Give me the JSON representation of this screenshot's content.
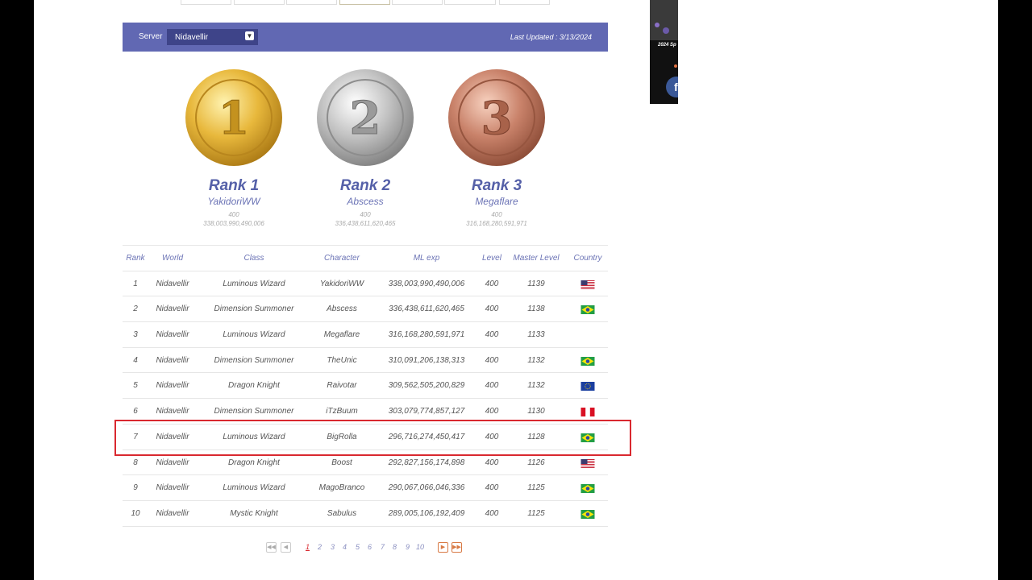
{
  "header": {
    "server_label": "Server",
    "server_value": "Nidavellir",
    "last_updated": "Last Updated : 3/13/2024"
  },
  "podium": [
    {
      "rank": "Rank 1",
      "name": "YakidoriWW",
      "level": "400",
      "exp": "338,003,990,490,006",
      "numeral": "1",
      "color": "#d9a632"
    },
    {
      "rank": "Rank 2",
      "name": "Abscess",
      "level": "400",
      "exp": "336,438,611,620,465",
      "numeral": "2",
      "color": "#a8a8a8"
    },
    {
      "rank": "Rank 3",
      "name": "Megaflare",
      "level": "400",
      "exp": "316,168,280,591,971",
      "numeral": "3",
      "color": "#c0775b"
    }
  ],
  "table": {
    "headers": {
      "rank": "Rank",
      "world": "World",
      "class": "Class",
      "character": "Character",
      "mlexp": "ML exp",
      "level": "Level",
      "master": "Master Level",
      "country": "Country"
    },
    "rows": [
      {
        "rank": "1",
        "world": "Nidavellir",
        "class": "Luminous Wizard",
        "character": "YakidoriWW",
        "mlexp": "338,003,990,490,006",
        "level": "400",
        "master": "1139",
        "flag": "us"
      },
      {
        "rank": "2",
        "world": "Nidavellir",
        "class": "Dimension Summoner",
        "character": "Abscess",
        "mlexp": "336,438,611,620,465",
        "level": "400",
        "master": "1138",
        "flag": "br"
      },
      {
        "rank": "3",
        "world": "Nidavellir",
        "class": "Luminous Wizard",
        "character": "Megaflare",
        "mlexp": "316,168,280,591,971",
        "level": "400",
        "master": "1133",
        "flag": ""
      },
      {
        "rank": "4",
        "world": "Nidavellir",
        "class": "Dimension Summoner",
        "character": "TheUnic",
        "mlexp": "310,091,206,138,313",
        "level": "400",
        "master": "1132",
        "flag": "br"
      },
      {
        "rank": "5",
        "world": "Nidavellir",
        "class": "Dragon Knight",
        "character": "Raivotar",
        "mlexp": "309,562,505,200,829",
        "level": "400",
        "master": "1132",
        "flag": "eu"
      },
      {
        "rank": "6",
        "world": "Nidavellir",
        "class": "Dimension Summoner",
        "character": "iTzBuum",
        "mlexp": "303,079,774,857,127",
        "level": "400",
        "master": "1130",
        "flag": "pe"
      },
      {
        "rank": "7",
        "world": "Nidavellir",
        "class": "Luminous Wizard",
        "character": "BigRolla",
        "mlexp": "296,716,274,450,417",
        "level": "400",
        "master": "1128",
        "flag": "br"
      },
      {
        "rank": "8",
        "world": "Nidavellir",
        "class": "Dragon Knight",
        "character": "Boost",
        "mlexp": "292,827,156,174,898",
        "level": "400",
        "master": "1126",
        "flag": "us"
      },
      {
        "rank": "9",
        "world": "Nidavellir",
        "class": "Luminous Wizard",
        "character": "MagoBranco",
        "mlexp": "290,067,066,046,336",
        "level": "400",
        "master": "1125",
        "flag": "br"
      },
      {
        "rank": "10",
        "world": "Nidavellir",
        "class": "Mystic Knight",
        "character": "Sabulus",
        "mlexp": "289,005,106,192,409",
        "level": "400",
        "master": "1125",
        "flag": "br"
      }
    ]
  },
  "pager": {
    "pages": [
      "1",
      "2",
      "3",
      "4",
      "5",
      "6",
      "7",
      "8",
      "9",
      "10"
    ],
    "current": "1",
    "first_icon": "double-chevron-left-icon",
    "prev_icon": "chevron-left-icon",
    "next_icon": "chevron-right-icon",
    "last_icon": "double-chevron-right-icon"
  },
  "ad": {
    "caption": "2024 Sp"
  },
  "colors": {
    "header_bar": "#6168b3",
    "accent_text": "#5560a8",
    "highlight": "#d9282f"
  }
}
